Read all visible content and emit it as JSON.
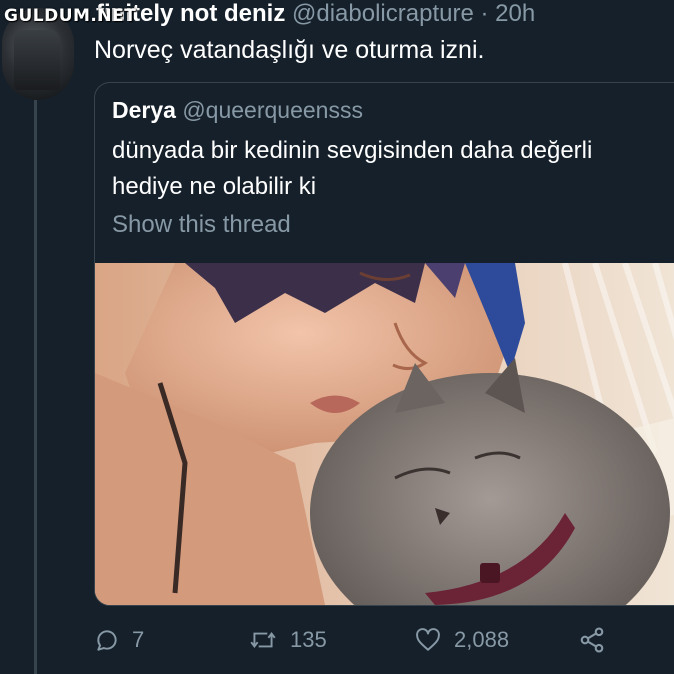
{
  "watermark": "GULDUM.NET",
  "tweet": {
    "author_name": "definitely not deniz",
    "author_name_visible": "finitely not deniz",
    "handle": "@diabolicrapture",
    "separator": "·",
    "time": "20h",
    "text": "Norveç vatandaşlığı ve oturma izni."
  },
  "quote": {
    "author_name": "Derya",
    "handle": "@queerqueensss",
    "text_line1": "dünyada bir kedinin sevgisinden daha değerli",
    "text_line2": "hediye ne olabilir ki",
    "show_thread": "Show this thread",
    "photo_desc_icon": "photo-woman-kissing-cat"
  },
  "actions": {
    "replies": "7",
    "retweets": "135",
    "likes": "2,088"
  },
  "colors": {
    "background": "#15202b",
    "border": "#38444d",
    "secondary_text": "#8899a6",
    "primary_text": "#ffffff"
  }
}
